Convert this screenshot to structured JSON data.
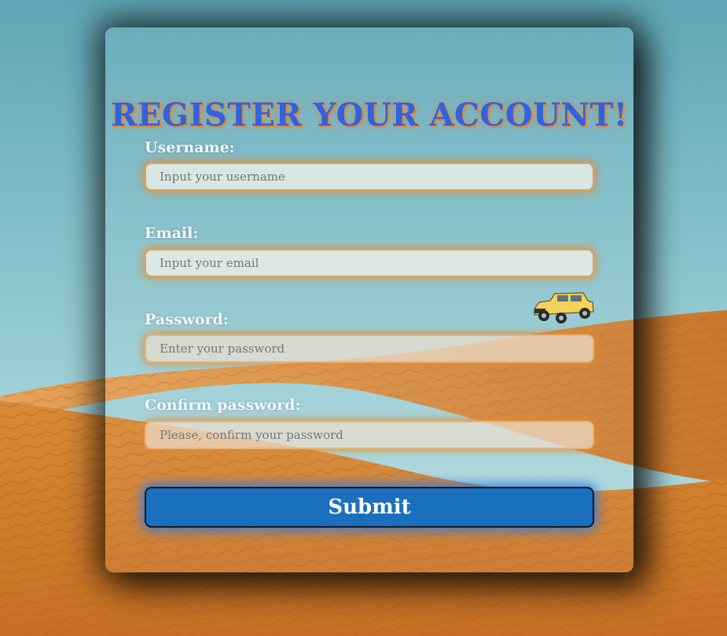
{
  "form": {
    "title": "REGISTER YOUR ACCOUNT!",
    "fields": [
      {
        "label": "Username:",
        "placeholder": "Input your username",
        "value": ""
      },
      {
        "label": "Email:",
        "placeholder": "Input your email",
        "value": ""
      },
      {
        "label": "Password:",
        "placeholder": "Enter your password",
        "value": ""
      },
      {
        "label": "Confirm password:",
        "placeholder": "Please, confirm your password",
        "value": ""
      }
    ],
    "submit_label": "Submit"
  },
  "colors": {
    "title": "#2f63e0",
    "title_glow": "#e0873a",
    "button": "#1a70bd",
    "input_glow": "#e48c32",
    "sky": "#7fbdc8",
    "sand": "#d88733"
  }
}
